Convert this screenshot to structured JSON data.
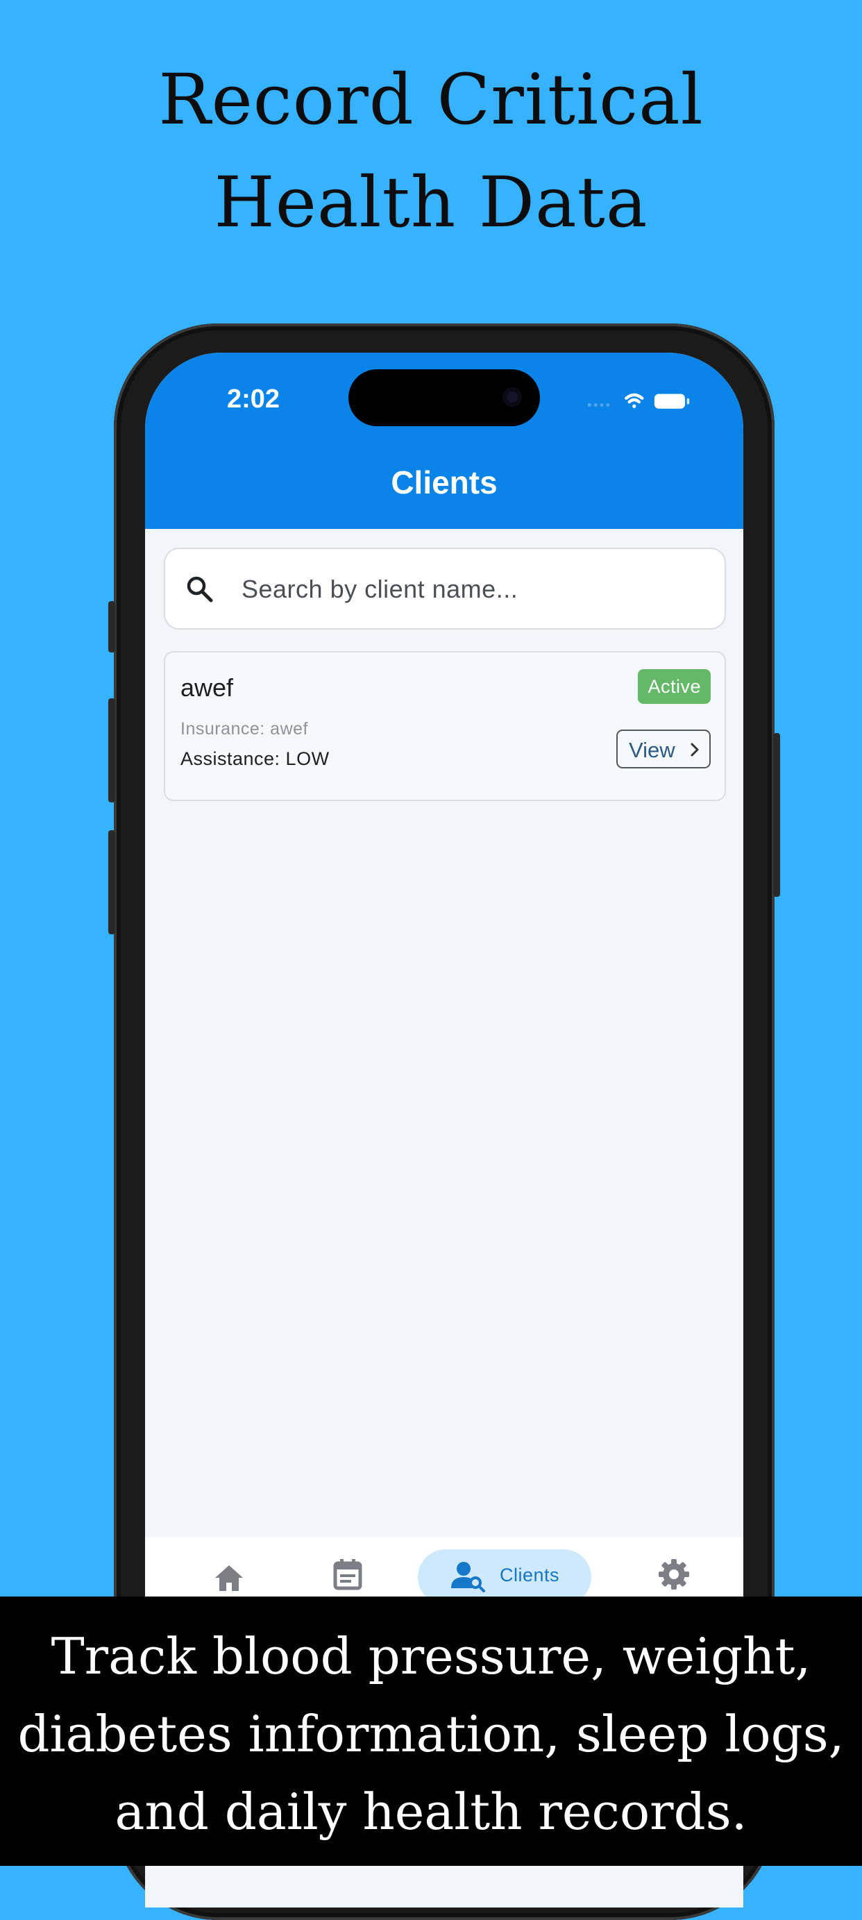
{
  "headline": {
    "line1": "Record Critical",
    "line2": "Health Data"
  },
  "status_bar": {
    "time": "2:02"
  },
  "app_bar": {
    "title": "Clients"
  },
  "search": {
    "placeholder": "Search by client name..."
  },
  "clients": [
    {
      "name": "awef",
      "status": "Active",
      "insurance": "Insurance: awef",
      "assistance": "Assistance: LOW",
      "view_label": "View"
    }
  ],
  "bottom_nav": {
    "items": [
      {
        "icon": "home-icon",
        "label": ""
      },
      {
        "icon": "calendar-icon",
        "label": ""
      },
      {
        "icon": "client-search-icon",
        "label": "Clients",
        "active": true
      },
      {
        "icon": "gear-icon",
        "label": ""
      }
    ]
  },
  "footer": {
    "line1": "Track blood pressure, weight,",
    "line2": "diabetes information, sleep logs,",
    "line3": "and daily health records."
  },
  "colors": {
    "background": "#36b2fe",
    "app_bar": "#0a84e8",
    "badge_active": "#65b867",
    "nav_active_pill": "#cde9fb"
  }
}
